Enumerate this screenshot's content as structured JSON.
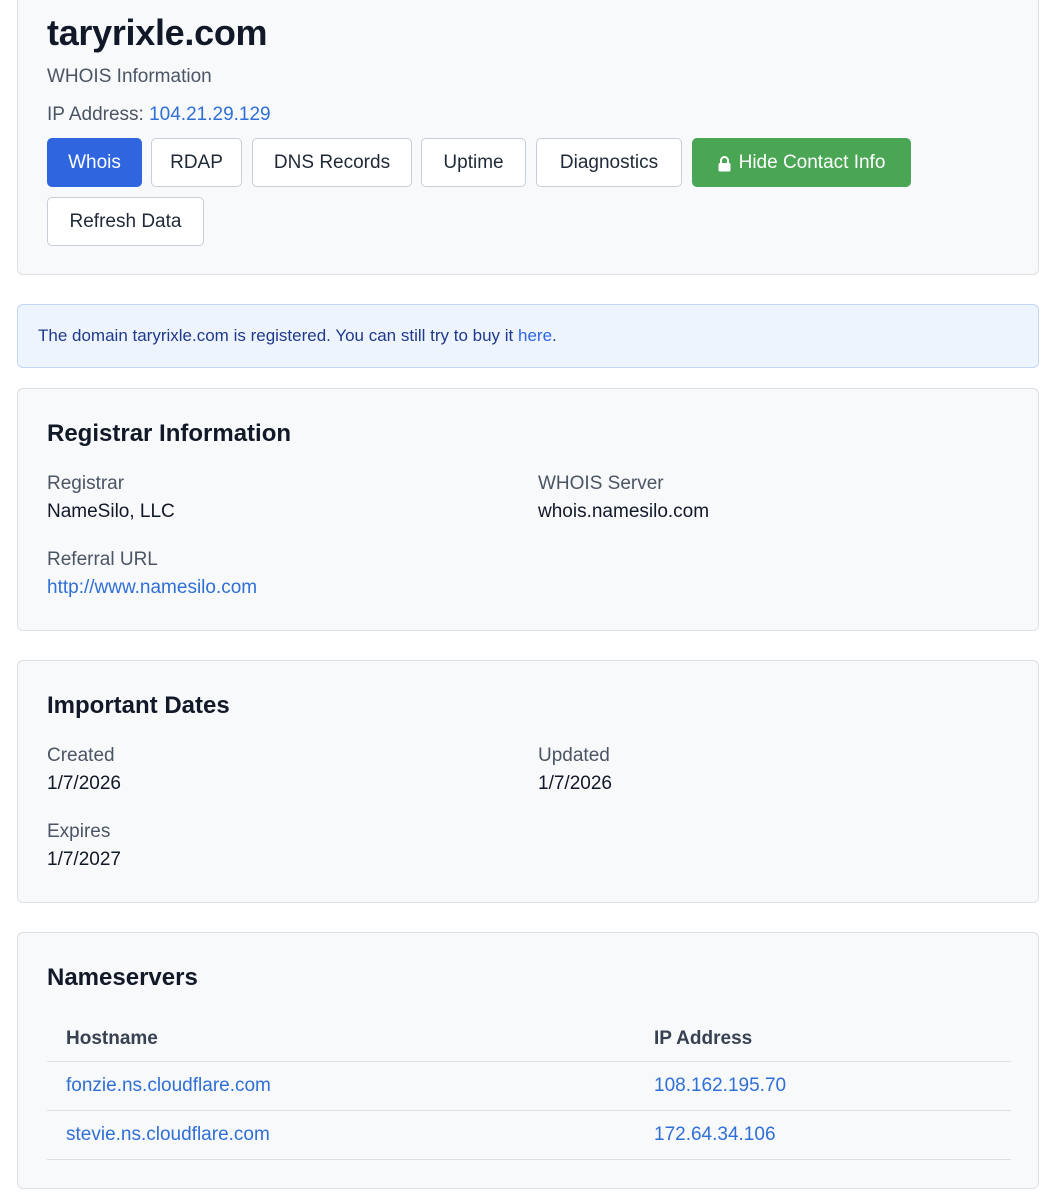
{
  "header": {
    "domain": "taryrixle.com",
    "subtitle": "WHOIS Information",
    "ip_label": "IP Address:",
    "ip_value": "104.21.29.129",
    "buttons": {
      "whois": "Whois",
      "rdap": "RDAP",
      "dns": "DNS Records",
      "uptime": "Uptime",
      "diagnostics": "Diagnostics",
      "hide_contact": "Hide Contact Info",
      "refresh": "Refresh Data"
    },
    "icons": {
      "hide_contact": "lock-icon"
    },
    "colors": {
      "primary": "#2f66e0",
      "success": "#4aa654",
      "link": "#2f6fd6"
    }
  },
  "alert": {
    "prefix": "The domain ",
    "domain": "taryrixle.com",
    "middle": " is registered. You can still try to buy it ",
    "link_text": "here",
    "suffix": "."
  },
  "registrar": {
    "title": "Registrar Information",
    "registrar_label": "Registrar",
    "registrar_value": "NameSilo, LLC",
    "whois_server_label": "WHOIS Server",
    "whois_server_value": "whois.namesilo.com",
    "referral_label": "Referral URL",
    "referral_value": "http://www.namesilo.com"
  },
  "dates": {
    "title": "Important Dates",
    "created_label": "Created",
    "created_value": "1/7/2026",
    "updated_label": "Updated",
    "updated_value": "1/7/2026",
    "expires_label": "Expires",
    "expires_value": "1/7/2027"
  },
  "nameservers": {
    "title": "Nameservers",
    "columns": [
      "Hostname",
      "IP Address"
    ],
    "rows": [
      {
        "hostname": "fonzie.ns.cloudflare.com",
        "ip": "108.162.195.70"
      },
      {
        "hostname": "stevie.ns.cloudflare.com",
        "ip": "172.64.34.106"
      }
    ]
  }
}
